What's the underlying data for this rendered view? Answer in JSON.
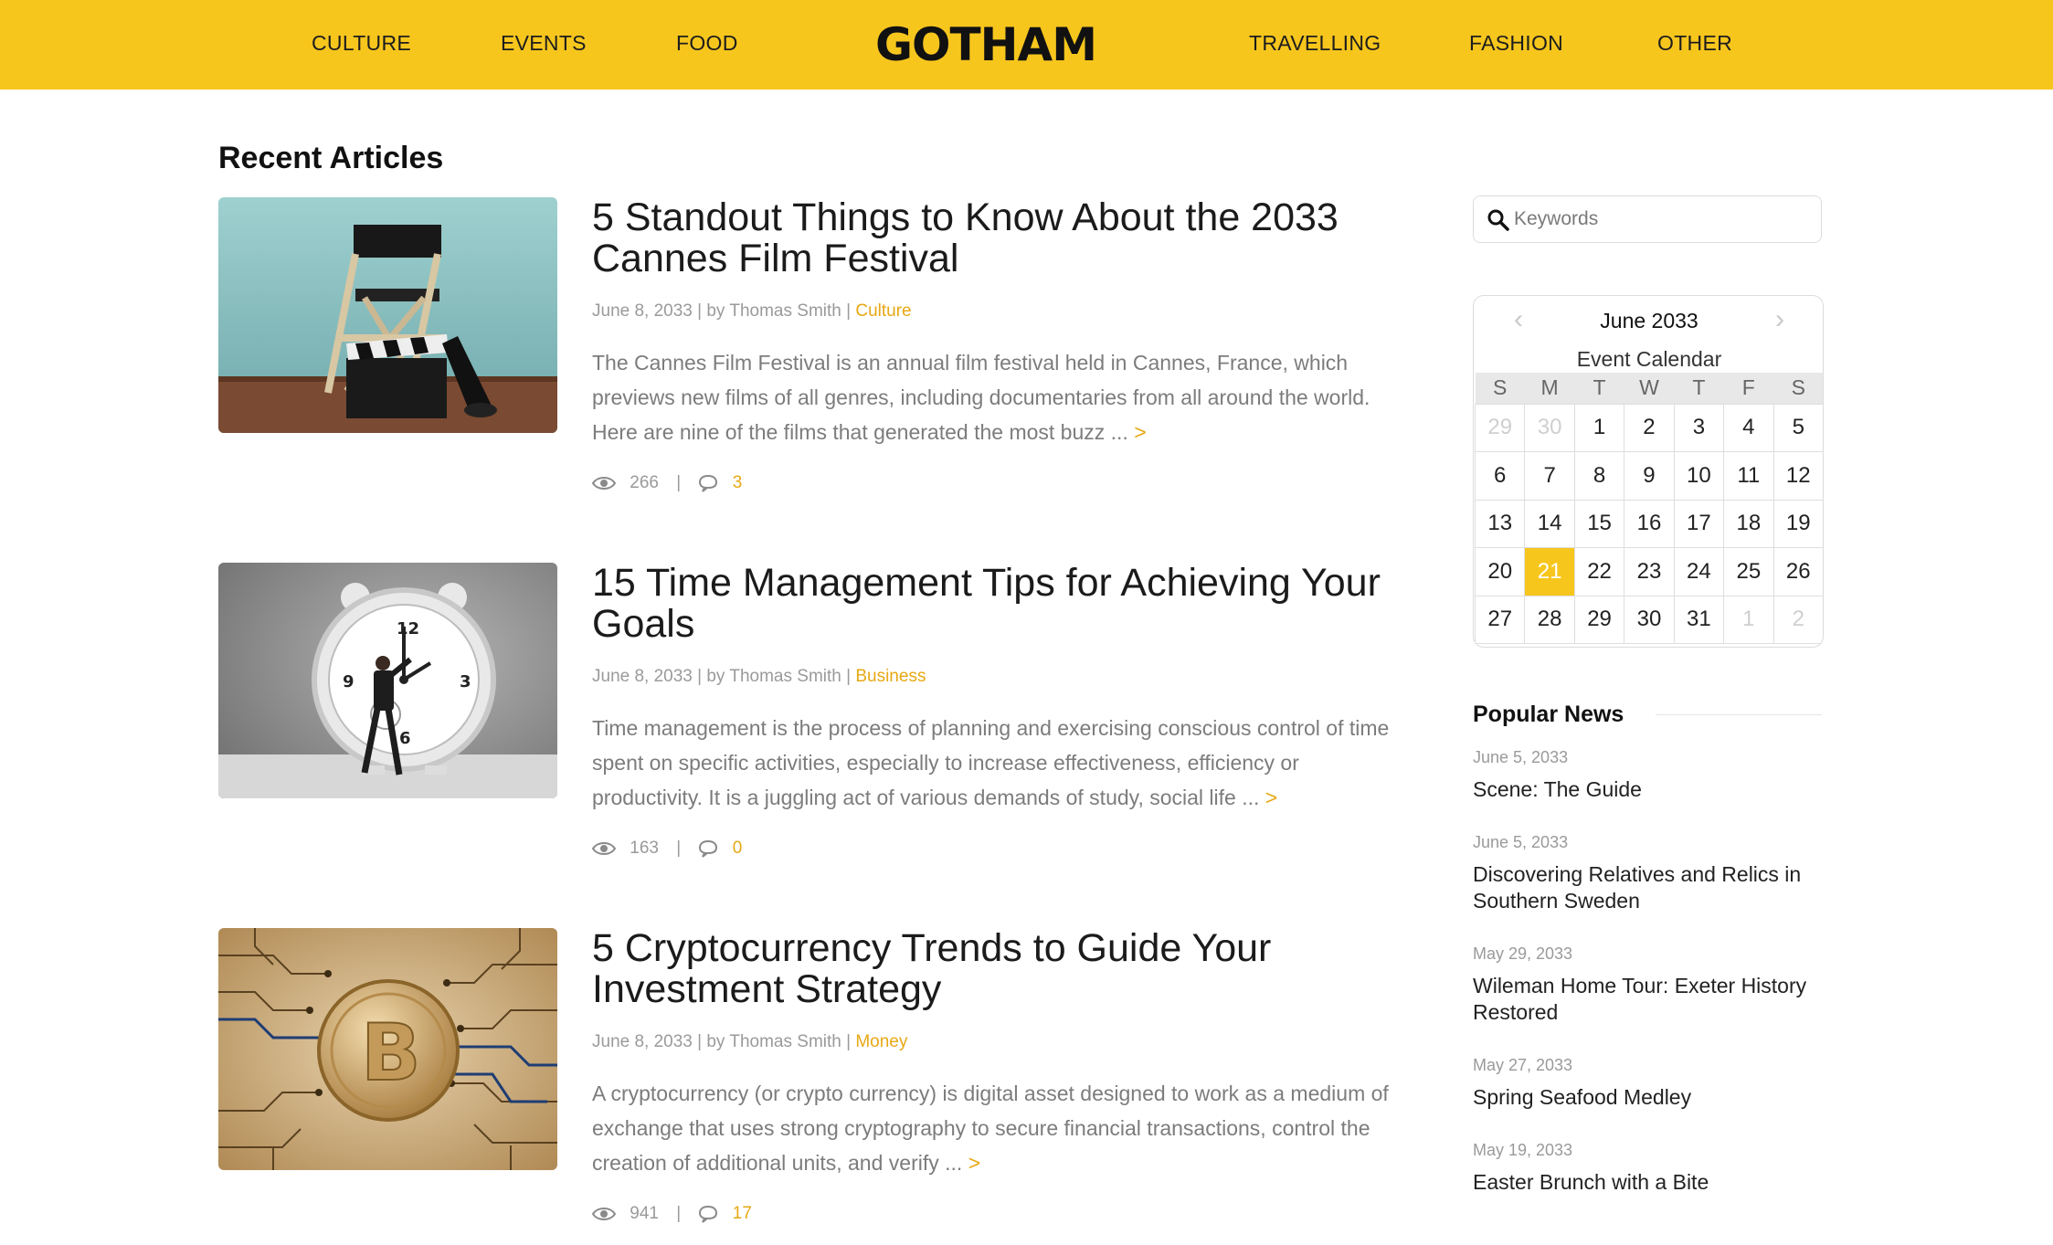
{
  "brand": {
    "logo_text": "GOTHAM",
    "accent_color": "#f7c61d",
    "link_color": "#e7a813"
  },
  "nav": {
    "left": [
      "CULTURE",
      "EVENTS",
      "FOOD"
    ],
    "right": [
      "TRAVELLING",
      "FASHION",
      "OTHER"
    ]
  },
  "main": {
    "section_title": "Recent Articles",
    "articles": [
      {
        "title": "5 Standout Things to Know About the 2033 Cannes Film Festival",
        "date_author": "June 8, 2033 | by Thomas Smith | ",
        "category": "Culture",
        "excerpt": "The Cannes Film Festival is an annual film festival held in Cannes, France, which previews new films of all genres, including documentaries from all around the world. Here are nine of the films that generated the most buzz ... ",
        "more": ">",
        "views": "266",
        "comments": "3",
        "image_icon": "director-chair-clapperboard-image"
      },
      {
        "title": "15 Time Management Tips for Achieving Your Goals",
        "date_author": "June 8, 2033 | by Thomas Smith | ",
        "category": "Business",
        "excerpt": "Time management is the process of planning and exercising conscious control of time spent on specific activities, especially to increase effectiveness, efficiency or productivity. It is a juggling act of various demands of study, social life ... ",
        "more": ">",
        "views": "163",
        "comments": "0",
        "image_icon": "alarm-clock-image"
      },
      {
        "title": "5 Cryptocurrency Trends to Guide Your Investment Strategy",
        "date_author": "June 8, 2033 | by Thomas Smith | ",
        "category": "Money",
        "excerpt": "A cryptocurrency (or crypto currency) is digital asset designed to work as a medium of exchange that uses strong cryptography to secure financial transactions, control the creation of additional units, and verify ... ",
        "more": ">",
        "views": "941",
        "comments": "17",
        "image_icon": "bitcoin-circuit-image"
      }
    ],
    "stat_separator": "|"
  },
  "sidebar": {
    "search": {
      "placeholder": "Keywords",
      "value": ""
    },
    "calendar": {
      "month_label": "June 2033",
      "caption": "Event Calendar",
      "prev_icon": "chevron-left-icon",
      "next_icon": "chevron-right-icon",
      "weekdays": [
        "S",
        "M",
        "T",
        "W",
        "T",
        "F",
        "S"
      ],
      "weeks": [
        [
          "29",
          "30",
          "1",
          "2",
          "3",
          "4",
          "5"
        ],
        [
          "6",
          "7",
          "8",
          "9",
          "10",
          "11",
          "12"
        ],
        [
          "13",
          "14",
          "15",
          "16",
          "17",
          "18",
          "19"
        ],
        [
          "20",
          "21",
          "22",
          "23",
          "24",
          "25",
          "26"
        ],
        [
          "27",
          "28",
          "29",
          "30",
          "31",
          "1",
          "2"
        ]
      ],
      "muted_cells": [
        [
          0,
          0
        ],
        [
          0,
          1
        ],
        [
          4,
          5
        ],
        [
          4,
          6
        ]
      ],
      "today_cell": [
        3,
        1
      ]
    },
    "popular": {
      "title": "Popular News",
      "items": [
        {
          "date": "June 5, 2033",
          "title": "Scene: The Guide"
        },
        {
          "date": "June 5, 2033",
          "title": "Discovering Relatives and Relics in Southern Sweden"
        },
        {
          "date": "May 29, 2033",
          "title": "Wileman Home Tour: Exeter History Restored"
        },
        {
          "date": "May 27, 2033",
          "title": "Spring Seafood Medley"
        },
        {
          "date": "May 19, 2033",
          "title": "Easter Brunch with a Bite"
        }
      ]
    }
  }
}
